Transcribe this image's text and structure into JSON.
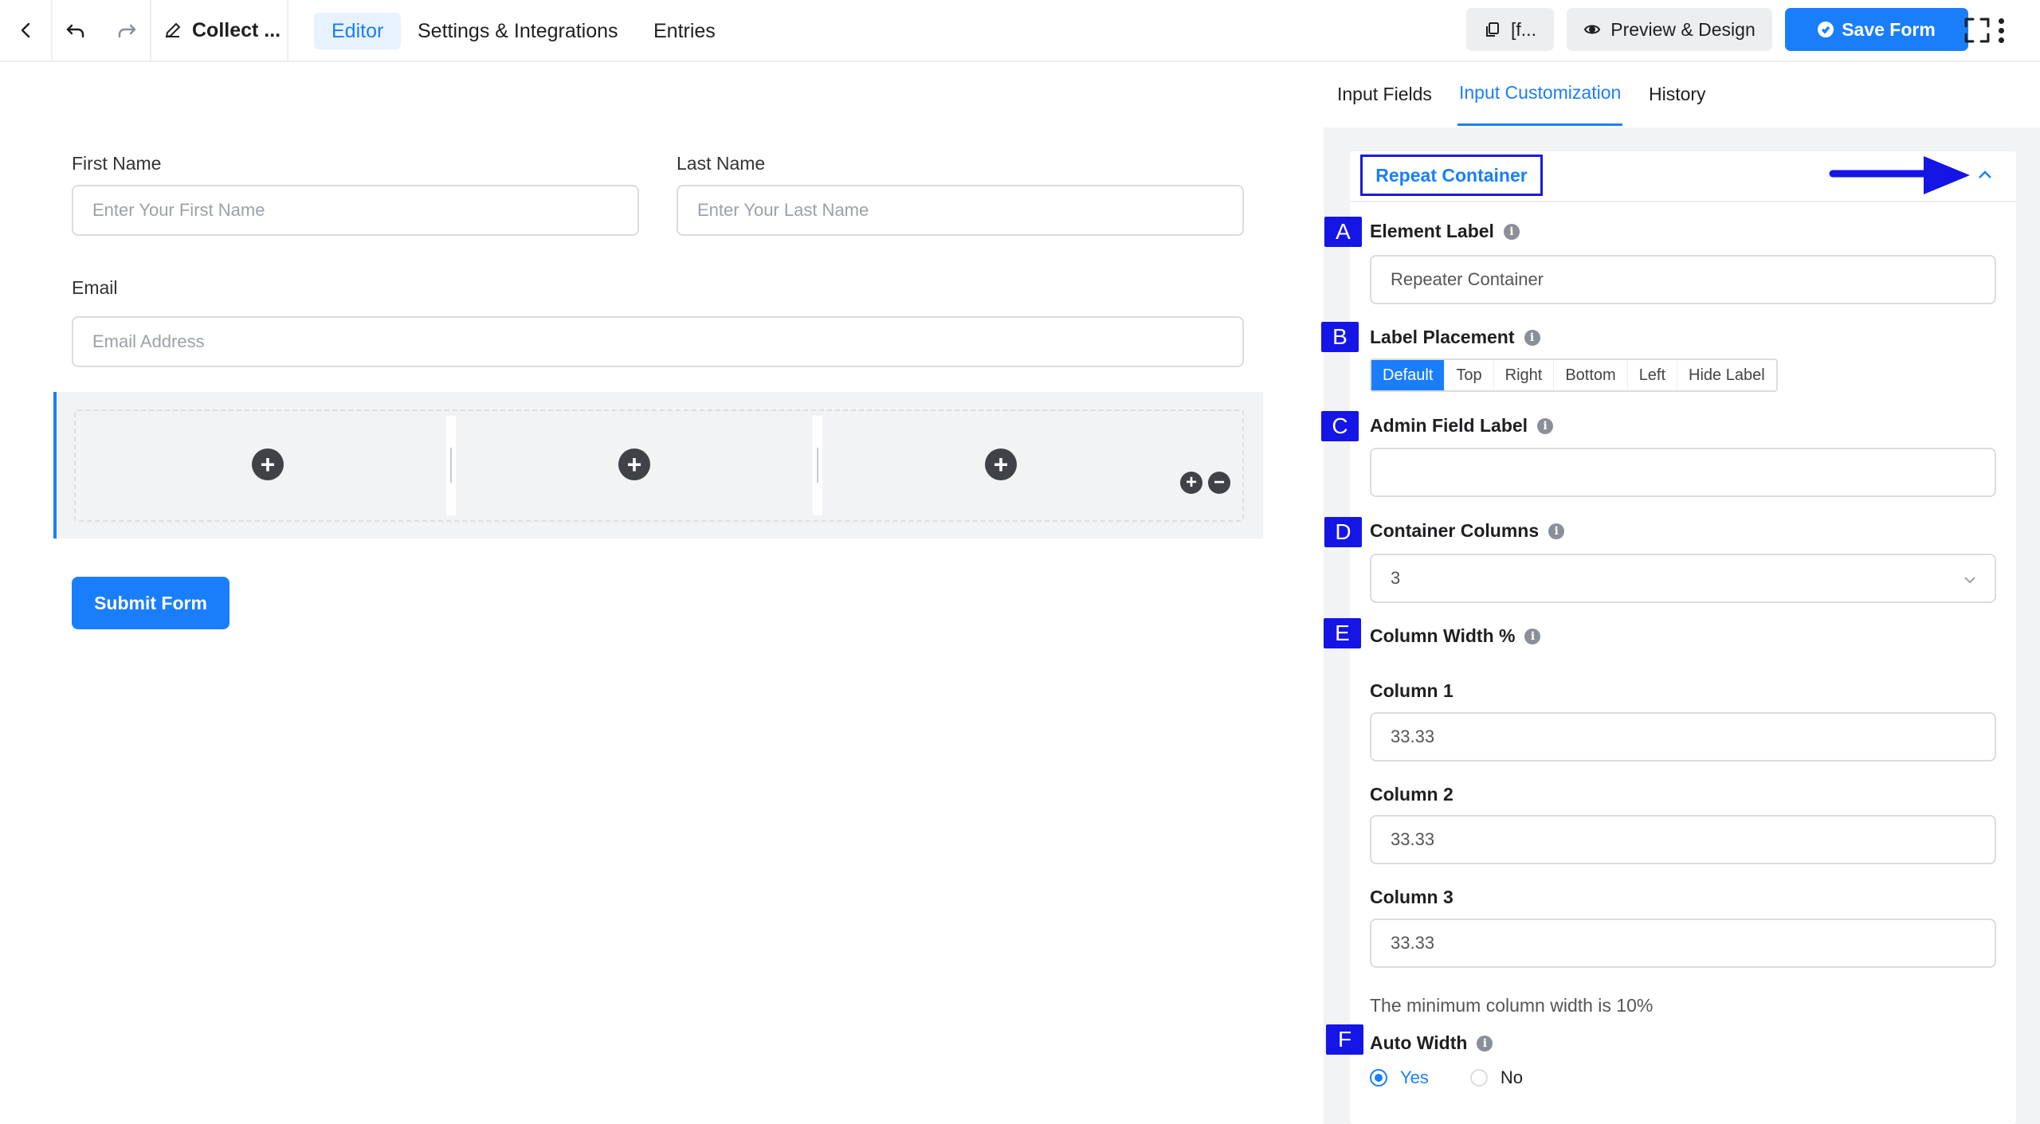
{
  "topbar": {
    "form_title": "Collect ...",
    "tabs": [
      {
        "label": "Editor",
        "active": true
      },
      {
        "label": "Settings & Integrations",
        "active": false
      },
      {
        "label": "Entries",
        "active": false
      }
    ],
    "shortcode_label": "[f...",
    "preview_label": "Preview & Design",
    "save_label": "Save Form",
    "icons": {
      "back": "chevron-left-icon",
      "undo": "undo-icon",
      "redo": "redo-icon",
      "edit": "pencil-icon",
      "copy": "copy-icon",
      "preview": "eye-icon",
      "save": "check-circle-icon",
      "fullscreen": "fullscreen-icon",
      "more": "more-vertical-icon"
    }
  },
  "form": {
    "first_name": {
      "label": "First Name",
      "placeholder": "Enter Your First Name"
    },
    "last_name": {
      "label": "Last Name",
      "placeholder": "Enter Your Last Name"
    },
    "email": {
      "label": "Email",
      "placeholder": "Email Address"
    },
    "repeater": {
      "column_count": 3,
      "add_symbol": "+",
      "remove_symbol": "−"
    },
    "submit_label": "Submit Form"
  },
  "panel": {
    "tabs": [
      {
        "label": "Input Fields",
        "active": false
      },
      {
        "label": "Input Customization",
        "active": true
      },
      {
        "label": "History",
        "active": false
      }
    ],
    "section_title": "Repeat Container",
    "annotation_color": "#1515e6",
    "element_label": {
      "badge": "A",
      "label": "Element Label",
      "value": "Repeater Container"
    },
    "label_placement": {
      "badge": "B",
      "label": "Label Placement",
      "options": [
        "Default",
        "Top",
        "Right",
        "Bottom",
        "Left",
        "Hide Label"
      ],
      "selected": "Default"
    },
    "admin_field_label": {
      "badge": "C",
      "label": "Admin Field Label",
      "value": ""
    },
    "container_columns": {
      "badge": "D",
      "label": "Container Columns",
      "value": "3"
    },
    "column_width": {
      "badge": "E",
      "label": "Column Width %",
      "columns": [
        {
          "label": "Column 1",
          "value": "33.33"
        },
        {
          "label": "Column 2",
          "value": "33.33"
        },
        {
          "label": "Column 3",
          "value": "33.33"
        }
      ],
      "help": "The minimum column width is 10%"
    },
    "auto_width": {
      "badge": "F",
      "label": "Auto Width",
      "options": [
        {
          "label": "Yes",
          "selected": true
        },
        {
          "label": "No",
          "selected": false
        }
      ]
    }
  },
  "colors": {
    "accent": "#1a7efb",
    "annotation": "#1515e6",
    "panel_bg": "#f2f3f5"
  }
}
